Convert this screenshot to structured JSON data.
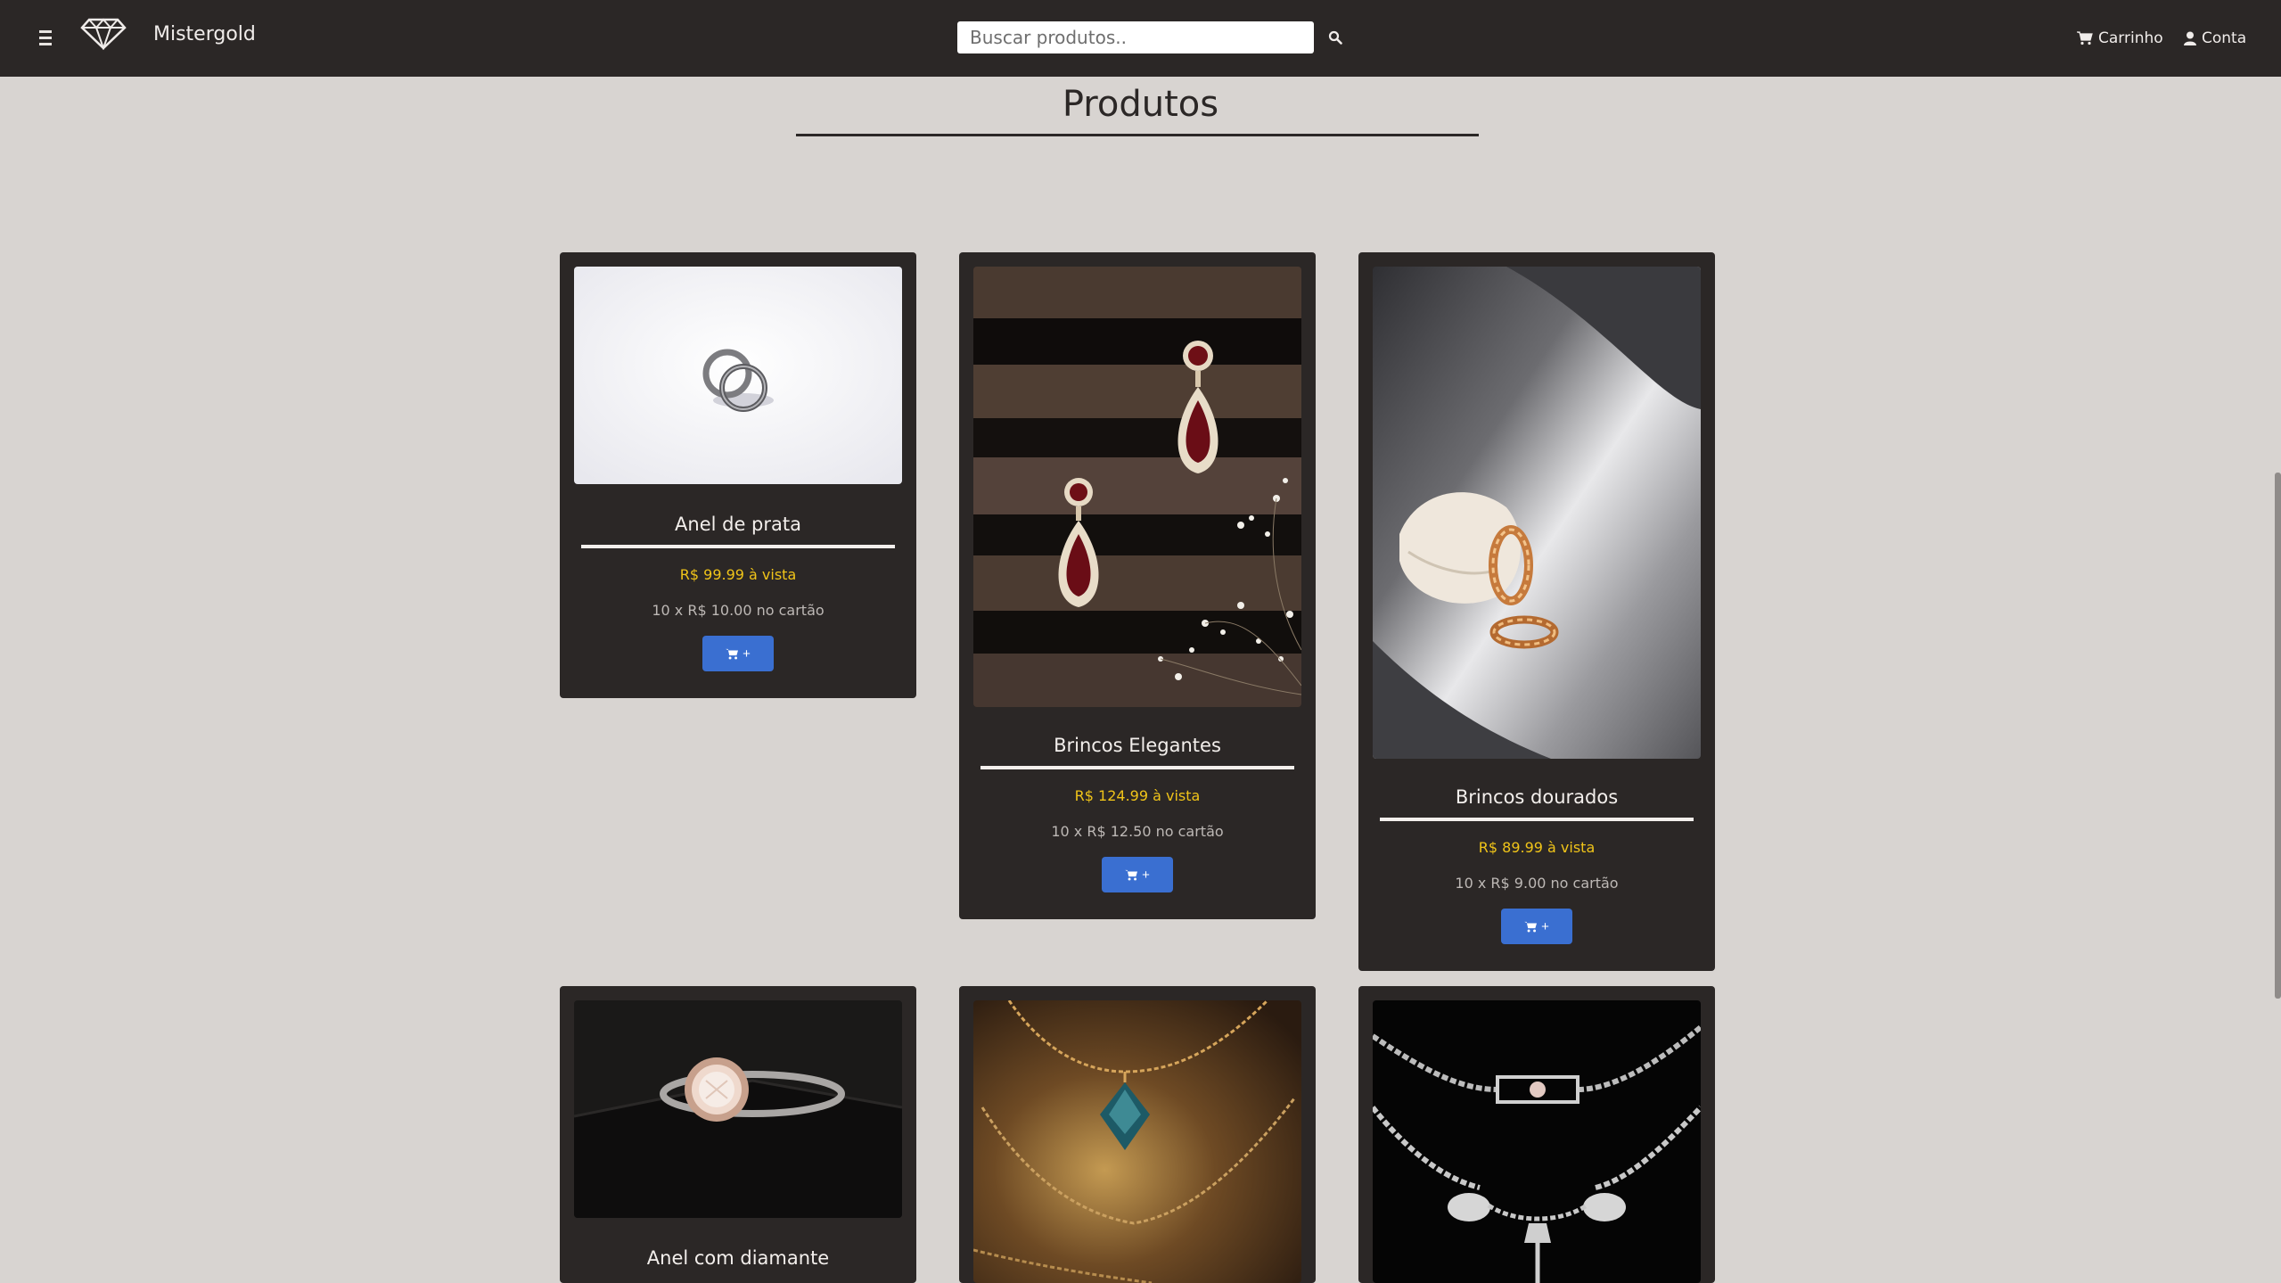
{
  "header": {
    "brand": "Mistergold",
    "search_placeholder": "Buscar produtos..",
    "cart_label": "Carrinho",
    "account_label": "Conta"
  },
  "page": {
    "title": "Produtos"
  },
  "colors": {
    "background": "#d8d4d1",
    "topbar": "#2b2726",
    "card": "#2b2726",
    "price": "#f0c419",
    "button": "#3a6fd1"
  },
  "products": [
    {
      "name": "Anel de prata",
      "price": "R$ 99.99 à vista",
      "installments": "10 x R$ 10.00 no cartão",
      "button_label": "+",
      "image": "silver-rings-photo"
    },
    {
      "name": "Brincos Elegantes",
      "price": "R$ 124.99 à vista",
      "installments": "10 x R$ 12.50 no cartão",
      "button_label": "+",
      "image": "ruby-drop-earrings-photo"
    },
    {
      "name": "Brincos dourados",
      "price": "R$ 89.99 à vista",
      "installments": "10 x R$ 9.00 no cartão",
      "button_label": "+",
      "image": "gold-hoop-earrings-photo"
    },
    {
      "name": "Anel com diamante",
      "image": "diamond-ring-photo"
    },
    {
      "name": "",
      "image": "blue-pendant-necklace-photo"
    },
    {
      "name": "",
      "image": "diamond-necklace-photo"
    }
  ]
}
